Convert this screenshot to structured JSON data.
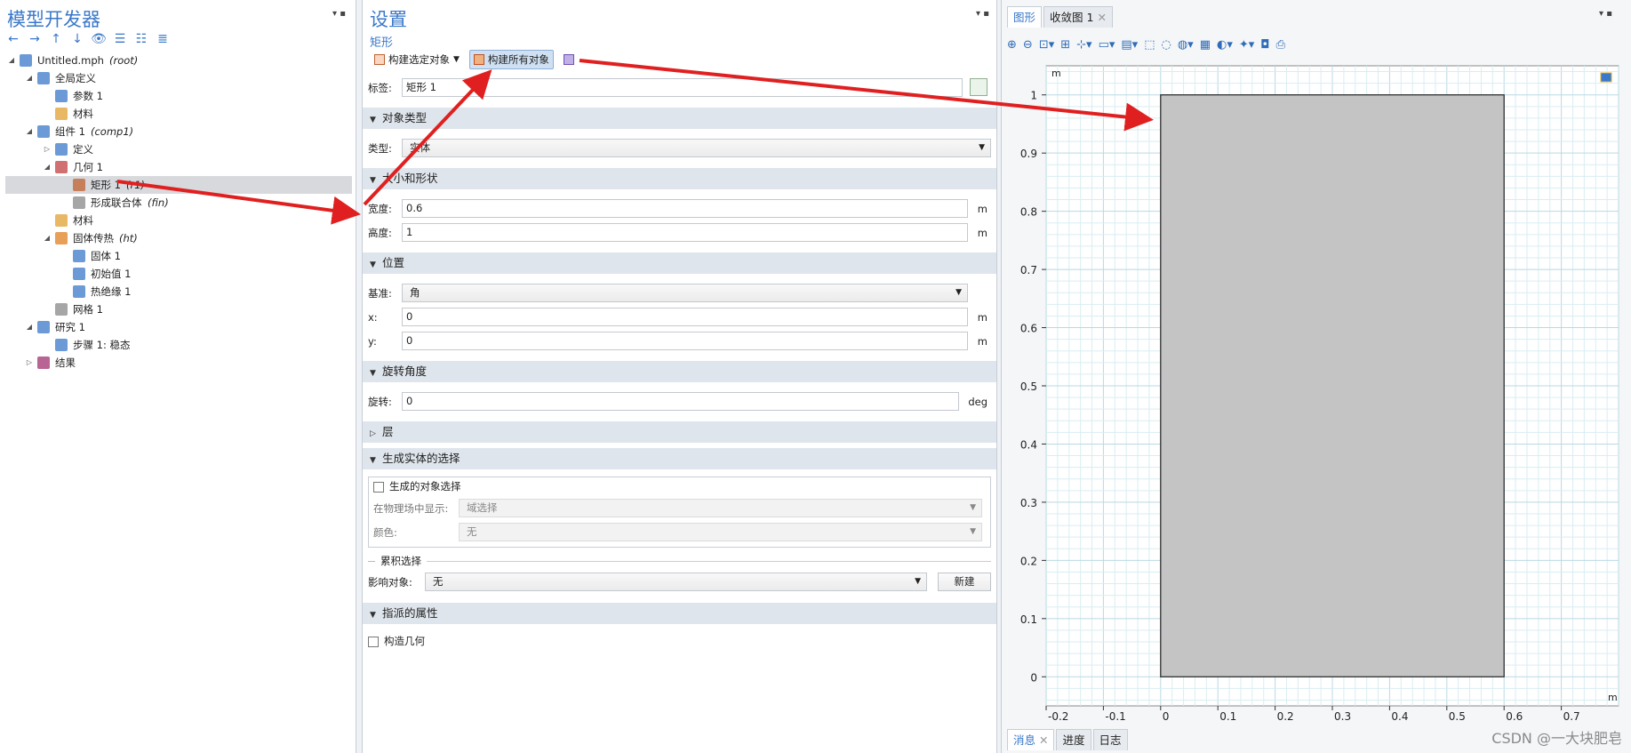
{
  "left": {
    "title": "模型开发器",
    "tree": [
      {
        "label": "Untitled.mph",
        "tag": "(root)",
        "level": 0,
        "twisty": "open",
        "icon": "file-icon",
        "color": "#3a78c9"
      },
      {
        "label": "全局定义",
        "tag": "",
        "level": 1,
        "twisty": "open",
        "icon": "globe-icon",
        "color": "#3a78c9"
      },
      {
        "label": "参数 1",
        "tag": "",
        "level": 2,
        "twisty": "",
        "icon": "parameter-icon",
        "color": "#3a78c9"
      },
      {
        "label": "材料",
        "tag": "",
        "level": 2,
        "twisty": "",
        "icon": "material-icon",
        "color": "#e0a030"
      },
      {
        "label": "组件 1",
        "tag": "(comp1)",
        "level": 1,
        "twisty": "open",
        "icon": "component-icon",
        "color": "#3a78c9"
      },
      {
        "label": "定义",
        "tag": "",
        "level": 2,
        "twisty": "closed",
        "icon": "definitions-icon",
        "color": "#3a78c9"
      },
      {
        "label": "几何 1",
        "tag": "",
        "level": 2,
        "twisty": "open",
        "icon": "geometry-icon",
        "color": "#c04040"
      },
      {
        "label": "矩形 1",
        "tag": "(r1)",
        "level": 3,
        "twisty": "",
        "icon": "rectangle-icon",
        "color": "#c06030",
        "selected": true
      },
      {
        "label": "形成联合体",
        "tag": "(fin)",
        "level": 3,
        "twisty": "",
        "icon": "form-union-icon",
        "color": "#888888"
      },
      {
        "label": "材料",
        "tag": "",
        "level": 2,
        "twisty": "",
        "icon": "material-icon",
        "color": "#e0a030"
      },
      {
        "label": "固体传热",
        "tag": "(ht)",
        "level": 2,
        "twisty": "open",
        "icon": "heat-transfer-icon",
        "color": "#e08020"
      },
      {
        "label": "固体 1",
        "tag": "",
        "level": 3,
        "twisty": "",
        "icon": "solid-icon",
        "color": "#3a78c9"
      },
      {
        "label": "初始值 1",
        "tag": "",
        "level": 3,
        "twisty": "",
        "icon": "initial-values-icon",
        "color": "#3a78c9"
      },
      {
        "label": "热绝缘 1",
        "tag": "",
        "level": 3,
        "twisty": "",
        "icon": "thermal-insulation-icon",
        "color": "#3a78c9"
      },
      {
        "label": "网格 1",
        "tag": "",
        "level": 2,
        "twisty": "",
        "icon": "mesh-icon",
        "color": "#888888"
      },
      {
        "label": "研究 1",
        "tag": "",
        "level": 1,
        "twisty": "open",
        "icon": "study-icon",
        "color": "#3a78c9"
      },
      {
        "label": "步骤 1: 稳态",
        "tag": "",
        "level": 2,
        "twisty": "",
        "icon": "step-icon",
        "color": "#3a78c9"
      },
      {
        "label": "结果",
        "tag": "",
        "level": 1,
        "twisty": "closed",
        "icon": "results-icon",
        "color": "#a03070"
      }
    ]
  },
  "mid": {
    "title": "设置",
    "subtitle": "矩形",
    "build_selected": "构建选定对象",
    "build_all": "构建所有对象",
    "label_caption": "标签:",
    "label_value": "矩形 1",
    "sec_object_type": "对象类型",
    "type_caption": "类型:",
    "type_value": "实体",
    "sec_size_shape": "大小和形状",
    "width_caption": "宽度:",
    "width_value": "0.6",
    "width_unit": "m",
    "height_caption": "高度:",
    "height_value": "1",
    "height_unit": "m",
    "sec_position": "位置",
    "base_caption": "基准:",
    "base_value": "角",
    "x_caption": "x:",
    "x_value": "0",
    "x_unit": "m",
    "y_caption": "y:",
    "y_value": "0",
    "y_unit": "m",
    "sec_rotation": "旋转角度",
    "rot_caption": "旋转:",
    "rot_value": "0",
    "rot_unit": "deg",
    "sec_layers": "层",
    "sec_selections": "生成实体的选择",
    "obj_sel_caption": "生成的对象选择",
    "show_in_physics_caption": "在物理场中显示:",
    "show_in_physics_value": "域选择",
    "color_caption": "颜色:",
    "color_value": "无",
    "cumulative_caption": "累积选择",
    "contribute_caption": "影响对象:",
    "contribute_value": "无",
    "new_button": "新建",
    "sec_assigned": "指派的属性",
    "construction_geom": "构造几何"
  },
  "right": {
    "tab_graphics": "图形",
    "tab_convergence": "收敛图 1",
    "bottom_tabs": [
      "消息",
      "进度",
      "日志"
    ],
    "unit_label": "m"
  },
  "chart_data": {
    "type": "geometry",
    "xlim": [
      -0.2,
      0.8
    ],
    "ylim": [
      -0.05,
      1.05
    ],
    "x_ticks": [
      -0.2,
      -0.1,
      0,
      0.1,
      0.2,
      0.3,
      0.4,
      0.5,
      0.6,
      0.7
    ],
    "y_ticks": [
      0,
      0.1,
      0.2,
      0.3,
      0.4,
      0.5,
      0.6,
      0.7,
      0.8,
      0.9,
      1
    ],
    "x_tick_labels": [
      "-0.2",
      "-0.1",
      "0",
      "0.1",
      "0.2",
      "0.3",
      "0.4",
      "0.5",
      "0.6",
      "0.7"
    ],
    "y_tick_labels": [
      "0",
      "0.1",
      "0.2",
      "0.3",
      "0.4",
      "0.5",
      "0.6",
      "0.7",
      "0.8",
      "0.9",
      "1"
    ],
    "rectangle": {
      "x0": 0,
      "y0": 0,
      "x1": 0.6,
      "y1": 1
    },
    "rect_fill": "#c4c4c4",
    "grid": true
  },
  "watermark": "CSDN @一大块肥皂",
  "colors": {
    "accent": "#3a78c9",
    "arrow": "#e02020"
  }
}
